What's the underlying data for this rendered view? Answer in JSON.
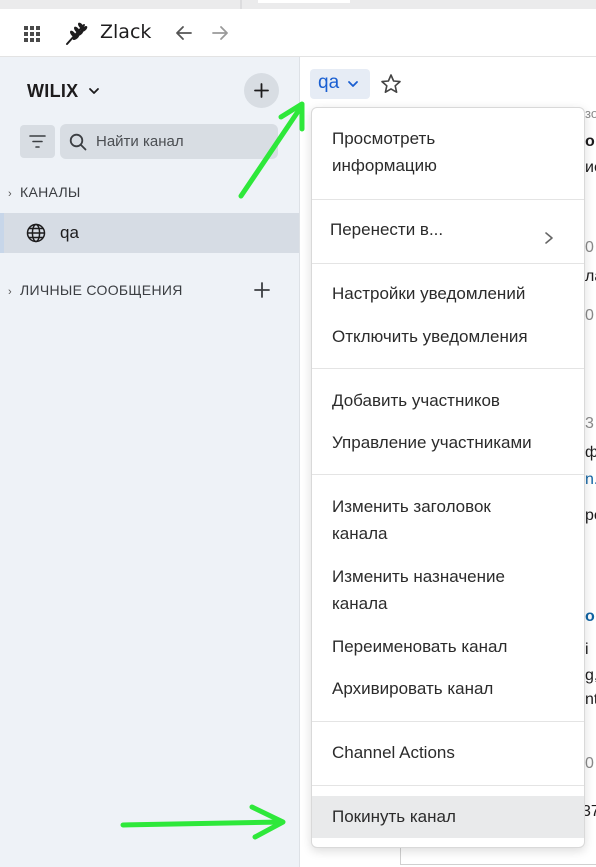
{
  "app": {
    "name": "Zlack"
  },
  "workspace": {
    "name": "WILIX"
  },
  "search": {
    "placeholder": "Найти канал"
  },
  "sidebar": {
    "channels_header": "КАНАЛЫ",
    "channels": [
      {
        "label": "qa"
      }
    ],
    "dm_header": "ЛИЧНЫЕ СООБЩЕНИЯ"
  },
  "channel_header": {
    "name": "qa"
  },
  "menu": {
    "items": [
      {
        "label_line1": "Просмотреть",
        "label_line2": "информацию"
      },
      {
        "label": "Перенести в..."
      },
      {
        "label": "Настройки уведомлений"
      },
      {
        "label": "Отключить уведомления"
      },
      {
        "label": "Добавить участников"
      },
      {
        "label": "Управление участниками"
      },
      {
        "label_line1": "Изменить заголовок",
        "label_line2": "канала"
      },
      {
        "label_line1": "Изменить назначение",
        "label_line2": "канала"
      },
      {
        "label": "Переименовать канал"
      },
      {
        "label": "Архивировать канал"
      },
      {
        "label": "Channel Actions"
      },
      {
        "label": "Покинуть канал",
        "highlighted": true
      }
    ]
  },
  "background_fragments": {
    "f1": "зо",
    "f2": "о",
    "f3": "ис",
    "f4": "0",
    "f5": "ла",
    "f6": "0",
    "f7": "3",
    "f8": "фе",
    "f9": "n.l",
    "f10": "ре",
    "f11": "о V",
    "f12": "i",
    "f13": "g,",
    "f14": "nt",
    "f15": "0",
    "f16": "37"
  },
  "colors": {
    "accent_link": "#1a5fd1",
    "annotation_arrow": "#2ee83a",
    "sidebar_bg": "#eef2f7"
  }
}
